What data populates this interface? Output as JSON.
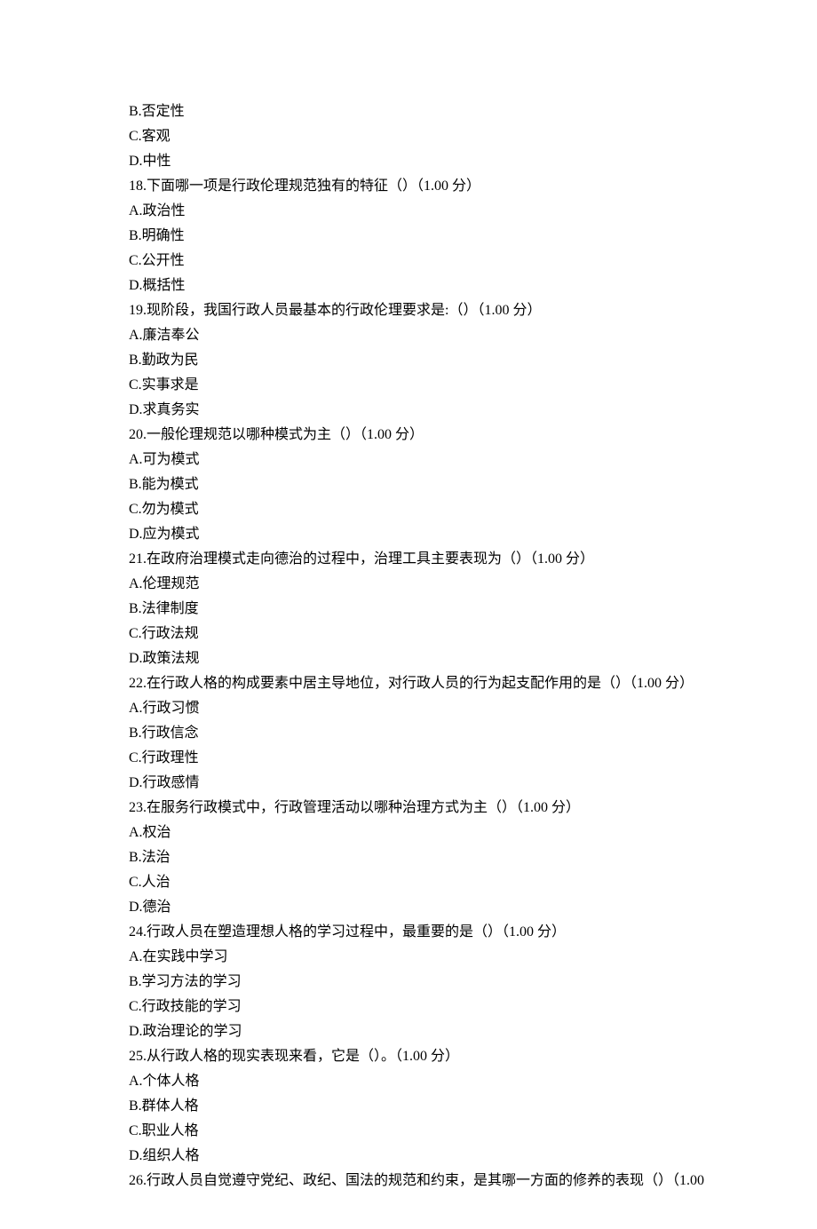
{
  "lines": [
    {
      "t": "B.否定性"
    },
    {
      "t": "C.客观"
    },
    {
      "t": "D.中性"
    },
    {
      "t": "18.下面哪一项是行政伦理规范独有的特征（）（1.00 分）"
    },
    {
      "t": "A.政治性"
    },
    {
      "t": "B.明确性"
    },
    {
      "t": "C.公开性"
    },
    {
      "t": "D.概括性"
    },
    {
      "t": "19.现阶段，我国行政人员最基本的行政伦理要求是:（）（1.00 分）"
    },
    {
      "t": "A.廉洁奉公"
    },
    {
      "t": "B.勤政为民"
    },
    {
      "t": "C.实事求是"
    },
    {
      "t": "D.求真务实"
    },
    {
      "t": "20.一般伦理规范以哪种模式为主（）（1.00 分）"
    },
    {
      "t": "A.可为模式"
    },
    {
      "t": "B.能为模式"
    },
    {
      "t": "C.勿为模式"
    },
    {
      "t": "D.应为模式"
    },
    {
      "t": "21.在政府治理模式走向德治的过程中，治理工具主要表现为（）（1.00 分）"
    },
    {
      "t": "A.伦理规范"
    },
    {
      "t": "B.法律制度"
    },
    {
      "t": "C.行政法规"
    },
    {
      "t": "D.政策法规"
    },
    {
      "t": "22.在行政人格的构成要素中居主导地位，对行政人员的行为起支配作用的是（）（1.00 分）"
    },
    {
      "t": "A.行政习惯"
    },
    {
      "t": "B.行政信念"
    },
    {
      "t": "C.行政理性"
    },
    {
      "t": "D.行政感情"
    },
    {
      "t": "23.在服务行政模式中，行政管理活动以哪种治理方式为主（）（1.00 分）"
    },
    {
      "t": "A.权治"
    },
    {
      "t": "B.法治"
    },
    {
      "t": "C.人治"
    },
    {
      "t": "D.德治"
    },
    {
      "t": "24.行政人员在塑造理想人格的学习过程中，最重要的是（）（1.00 分）"
    },
    {
      "t": "A.在实践中学习"
    },
    {
      "t": "B.学习方法的学习"
    },
    {
      "t": "C.行政技能的学习"
    },
    {
      "t": "D.政治理论的学习"
    },
    {
      "t": "25.从行政人格的现实表现来看，它是（）。（1.00 分）"
    },
    {
      "t": "A.个体人格"
    },
    {
      "t": "B.群体人格"
    },
    {
      "t": "C.职业人格"
    },
    {
      "t": "D.组织人格"
    },
    {
      "t": "26.行政人员自觉遵守党纪、政纪、国法的规范和约束，是其哪一方面的修养的表现（）（1.00"
    }
  ]
}
